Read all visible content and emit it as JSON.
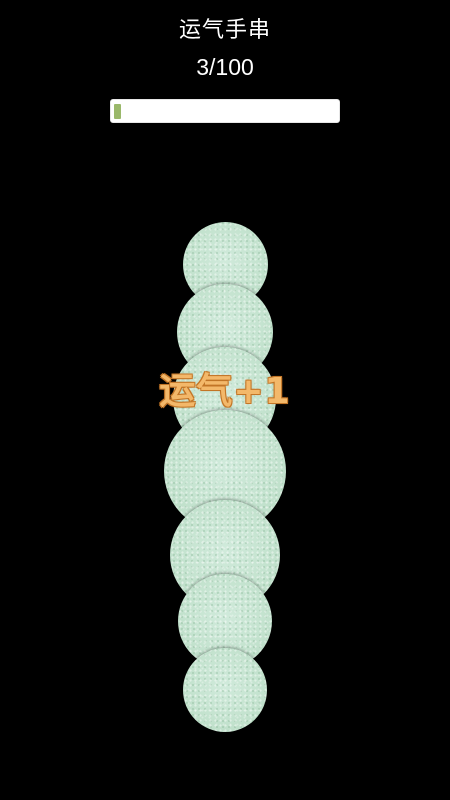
{
  "header": {
    "title": "运气手串",
    "count": "3/100"
  },
  "progress": {
    "current": 3,
    "total": 100,
    "fill_color": "#9ab86a",
    "track_color": "#ffffff"
  },
  "popup": {
    "text": "运气+1"
  },
  "bead": {
    "color": "#c4e3cf"
  }
}
